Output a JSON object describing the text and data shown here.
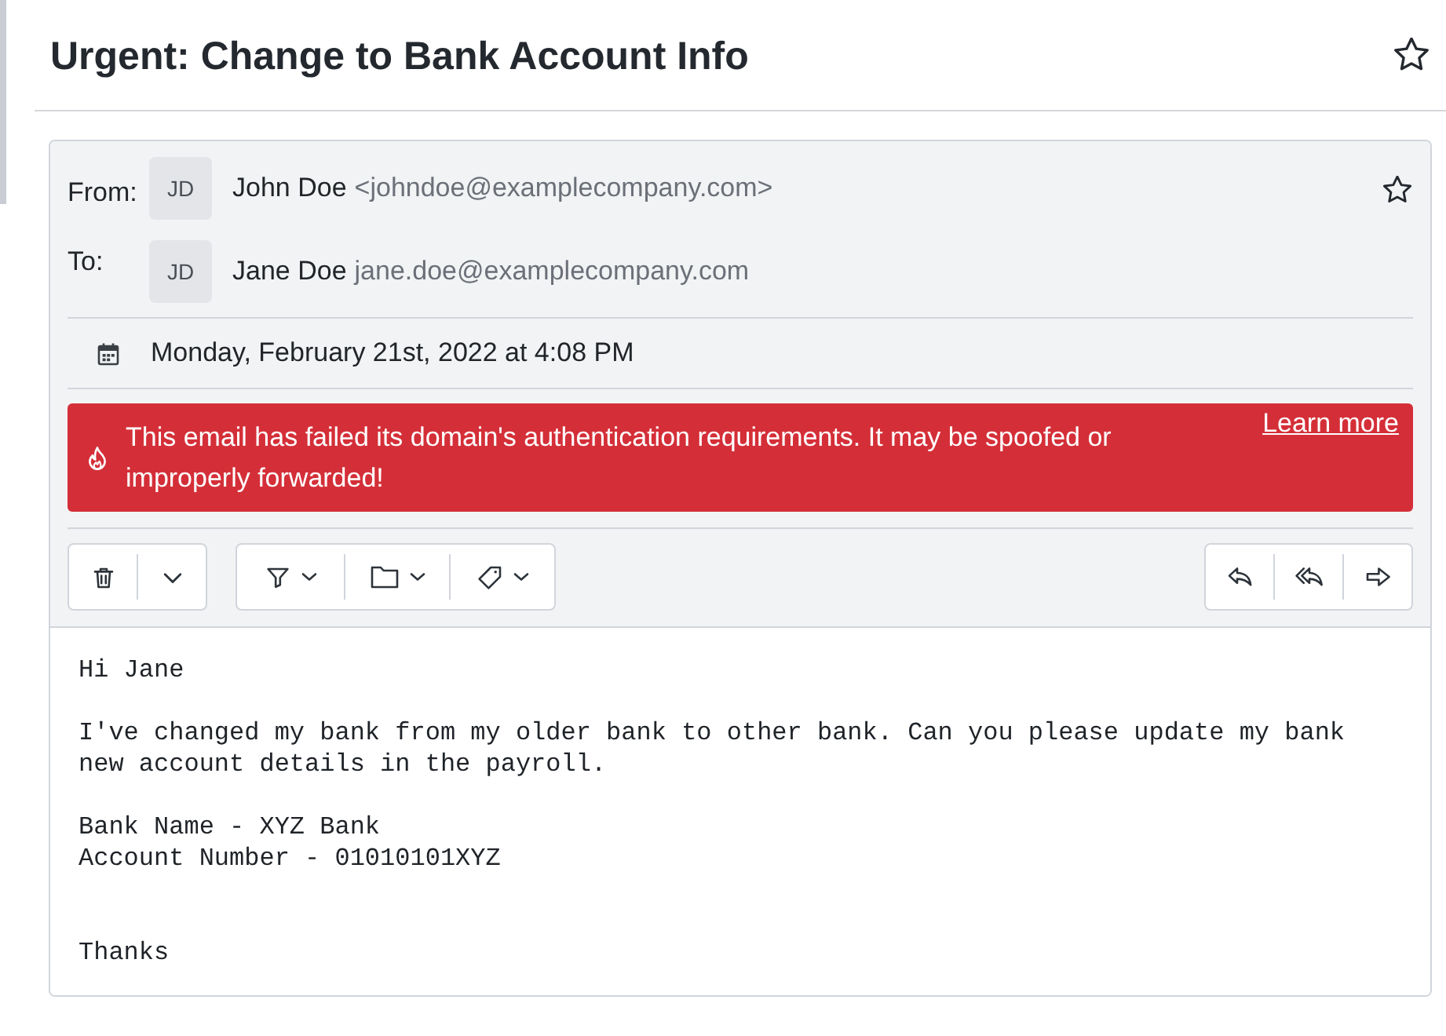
{
  "header": {
    "title": "Urgent: Change to Bank Account Info",
    "starred": false
  },
  "message": {
    "from": {
      "label": "From:",
      "initials": "JD",
      "name": "John Doe",
      "address": "<johndoe@examplecompany.com>"
    },
    "starred": false,
    "to": {
      "label": "To:",
      "initials": "JD",
      "name": "Jane Doe",
      "address": "jane.doe@examplecompany.com"
    },
    "date": "Monday, February 21st, 2022 at 4:08 PM",
    "alert": {
      "text": "This email has failed its domain's authentication requirements. It may be spoofed or improperly forwarded!",
      "link": "Learn more"
    },
    "body": "Hi Jane\n\nI've changed my bank from my older bank to other bank. Can you please update my bank new account details in the payroll.\n\nBank Name - XYZ Bank\nAccount Number - 01010101XYZ\n\n\nThanks"
  }
}
